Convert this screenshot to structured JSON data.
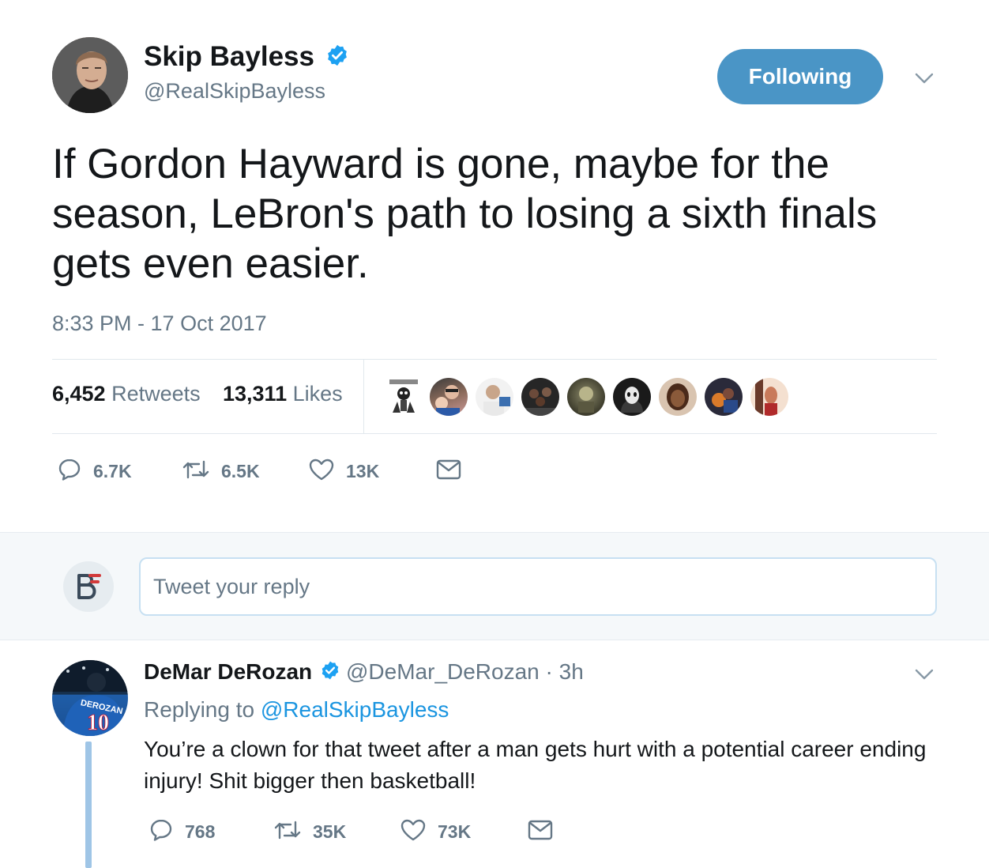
{
  "main_tweet": {
    "author_name": "Skip Bayless",
    "author_handle": "@RealSkipBayless",
    "follow_button_label": "Following",
    "text": "If Gordon Hayward is gone, maybe for the season, LeBron's path to losing a sixth finals gets even easier.",
    "timestamp": "8:33 PM - 17 Oct 2017",
    "retweets_count": "6,452",
    "retweets_label": "Retweets",
    "likes_count": "13,311",
    "likes_label": "Likes",
    "actions": {
      "reply_count": "6.7K",
      "retweet_count": "6.5K",
      "like_count": "13K"
    }
  },
  "reply_box": {
    "placeholder": "Tweet your reply"
  },
  "reply_tweet": {
    "author_name": "DeMar DeRozan",
    "author_handle": "@DeMar_DeRozan",
    "time_ago": "3h",
    "replying_to_prefix": "Replying to",
    "replying_to_handle": "@RealSkipBayless",
    "text": "You’re a clown for that tweet after a man gets hurt with a potential career ending injury! Shit bigger then basketball!",
    "actions": {
      "reply_count": "768",
      "retweet_count": "35K",
      "like_count": "73K"
    },
    "jersey_name": "DEROZAN",
    "jersey_number": "10"
  },
  "colors": {
    "accent": "#1b95e0",
    "following_button": "#4a95c6",
    "muted_text": "#657786",
    "verified_badge": "#1da1f2"
  },
  "icons": [
    "verified-badge-icon",
    "chevron-down-icon",
    "reply-icon",
    "retweet-icon",
    "like-icon",
    "direct-message-icon"
  ]
}
